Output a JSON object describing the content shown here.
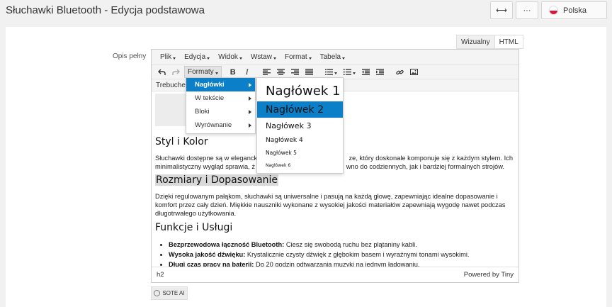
{
  "page": {
    "title": "Słuchawki Bluetooth - Edycja podstawowa"
  },
  "top_buttons": {
    "expand_icon": "⟷",
    "more_icon": "···",
    "language": "Polska"
  },
  "field_label": "Opis pełny",
  "mode_tabs": [
    "Wizualny",
    "HTML"
  ],
  "menubar": [
    "Plik",
    "Edycja",
    "Widok",
    "Wstaw",
    "Format",
    "Tabela"
  ],
  "toolbar": {
    "undo_icon": "undo-icon",
    "redo_icon": "redo-icon",
    "formats_label": "Formaty",
    "bold": "B",
    "italic": "I"
  },
  "font_row": "Trebuchet",
  "formats_menu": {
    "items": [
      {
        "label": "Nagłówki",
        "active": true
      },
      {
        "label": "W tekście",
        "active": false
      },
      {
        "label": "Bloki",
        "active": false
      },
      {
        "label": "Wyrównanie",
        "active": false
      }
    ]
  },
  "headings_submenu": {
    "items": [
      {
        "label": "Nagłówek 1",
        "active": false
      },
      {
        "label": "Nagłówek 2",
        "active": true
      },
      {
        "label": "Nagłówek 3",
        "active": false
      },
      {
        "label": "Nagłówek 4",
        "active": false
      },
      {
        "label": "Nagłówek 5",
        "active": false
      },
      {
        "label": "Nagłówek 6",
        "active": false
      }
    ]
  },
  "content": {
    "h_style": "Styl i Kolor",
    "p_style": "Słuchawki dostępne są w eleganck...ze, który doskonale komponuje się z każdym stylem. Ich minimalistyczny wygląd sprawia, ż...wno do codziennych, jak i bardziej formalnych strojów.",
    "p_style_line1_left": "Słuchawki dostępne są w eleganck",
    "p_style_line1_right": "ze, który doskonale komponuje się z każdym stylem. Ich",
    "p_style_line2_left": "minimalistyczny wygląd sprawia, ż",
    "p_style_line2_right": "wno do codziennych, jak i bardziej formalnych strojów.",
    "h_size": "Rozmiary i Dopasowanie",
    "p_size": "Dzięki regulowanym pałąkom, słuchawki są uniwersalne i pasują na każdą głowę, zapewniając idealne dopasowanie i komfort przez cały dzień. Miękkie nauszniki wykonane z wysokiej jakości materiałów zapewniają wygodę nawet podczas długotrwałego użytkowania.",
    "h_features": "Funkcje i Usługi",
    "bullets": [
      {
        "bold": "Bezprzewodowa łączność Bluetooth:",
        "text": " Ciesz się swobodą ruchu bez plątaniny kabli."
      },
      {
        "bold": "Wysoka jakość dźwięku:",
        "text": " Krystalicznie czysty dźwięk z głębokim basem i wyraźnymi tonami wysokimi."
      },
      {
        "bold": "Długi czas pracy na baterii:",
        "text": " Do 20 godzin odtwarzania muzyki na jednym ładowaniu."
      }
    ]
  },
  "statusbar": {
    "path": "h2",
    "brand": "Powered by Tiny"
  },
  "ai_button": "SOTE AI",
  "colors": {
    "accent": "#0b7fc7"
  }
}
